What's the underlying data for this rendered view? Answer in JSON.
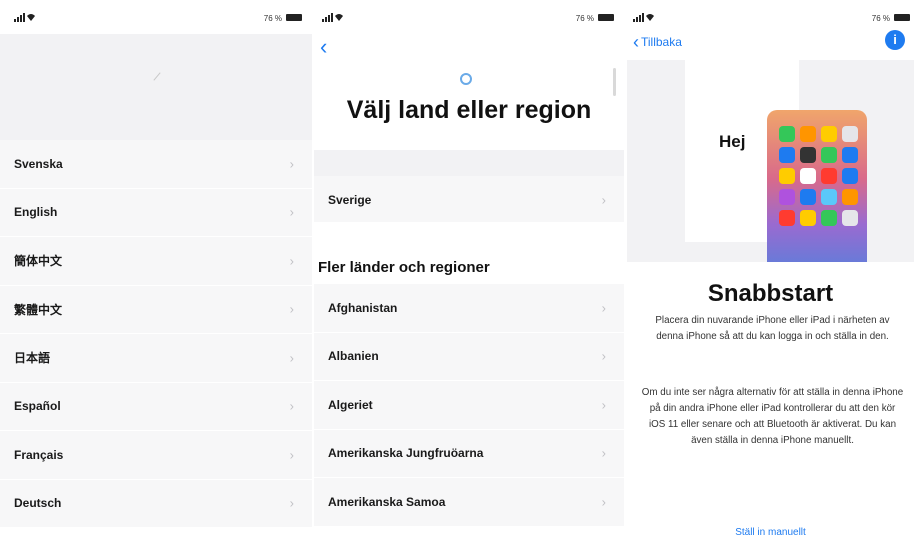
{
  "status_bar": {
    "battery": "76 %"
  },
  "screen1": {
    "languages": [
      "Svenska",
      "English",
      "簡体中文",
      "繁體中文",
      "日本語",
      "Español",
      "Français",
      "Deutsch"
    ]
  },
  "screen2": {
    "title": "Välj land eller region",
    "selected_country": "Sverige",
    "section_heading": "Fler länder och regioner",
    "countries": [
      "Afghanistan",
      "Albanien",
      "Algeriet",
      "Amerikanska Jungfruöarna",
      "Amerikanska Samoa"
    ]
  },
  "screen3": {
    "back_label": "Tillbaka",
    "illustration_text": "Hej",
    "headline": "Snabbstart",
    "paragraph1": "Placera din nuvarande iPhone eller iPad i närheten av denna iPhone så att du kan logga in och ställa in den.",
    "paragraph2": "Om du inte ser några alternativ för att ställa in denna iPhone på din andra iPhone eller iPad kontrollerar du att den kör iOS 11 eller senare och att Bluetooth är aktiverat. Du kan även ställa in denna iPhone manuellt.",
    "manual_link": "Ställ in manuellt",
    "app_colors": [
      "#34c759",
      "#ff9500",
      "#ffcc00",
      "#e5e5ea",
      "#1e7bf0",
      "#333333",
      "#34c759",
      "#1e7bf0",
      "#ffcc00",
      "#ffffff",
      "#ff3b30",
      "#1e7bf0",
      "#af52de",
      "#1e7bf0",
      "#5ac8fa",
      "#ff9500",
      "#ff3b30",
      "#ffcc00",
      "#34c759",
      "#e5e5ea"
    ]
  },
  "icons": {
    "chevron_right": "›",
    "chevron_left": "‹",
    "info": "i"
  }
}
